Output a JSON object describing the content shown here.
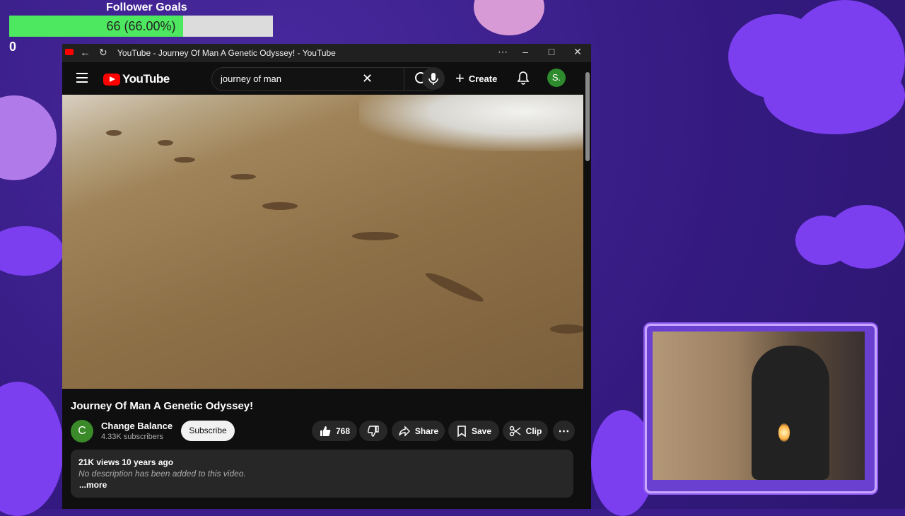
{
  "follower_goal": {
    "title": "Follower Goals",
    "progress_text": "66 (66.00%)",
    "progress": 0.66,
    "min_label": "0"
  },
  "window": {
    "title": "YouTube - Journey Of Man A Genetic Odyssey! - YouTube",
    "controls": [
      "more-icon",
      "minimize-icon",
      "maximize-icon",
      "close-icon"
    ]
  },
  "youtube": {
    "logo_text": "YouTube",
    "search_query": "journey of man",
    "create_label": "Create",
    "avatar_initial": "S."
  },
  "video": {
    "title": "Journey Of Man A Genetic Odyssey!",
    "channel": {
      "initial": "C",
      "name": "Change Balance",
      "subscribers": "4.33K subscribers"
    },
    "subscribe_label": "Subscribe",
    "likes": "768",
    "share_label": "Share",
    "save_label": "Save",
    "clip_label": "Clip",
    "views_meta": "21K views  10 years ago",
    "description": "No description has been added to this video.",
    "more_label": "...more"
  },
  "colors": {
    "yt_red": "#ff0000",
    "goal_fill": "#4de860",
    "bg_purple": "#3a1d8a",
    "cloud": "#7b3ff0"
  }
}
